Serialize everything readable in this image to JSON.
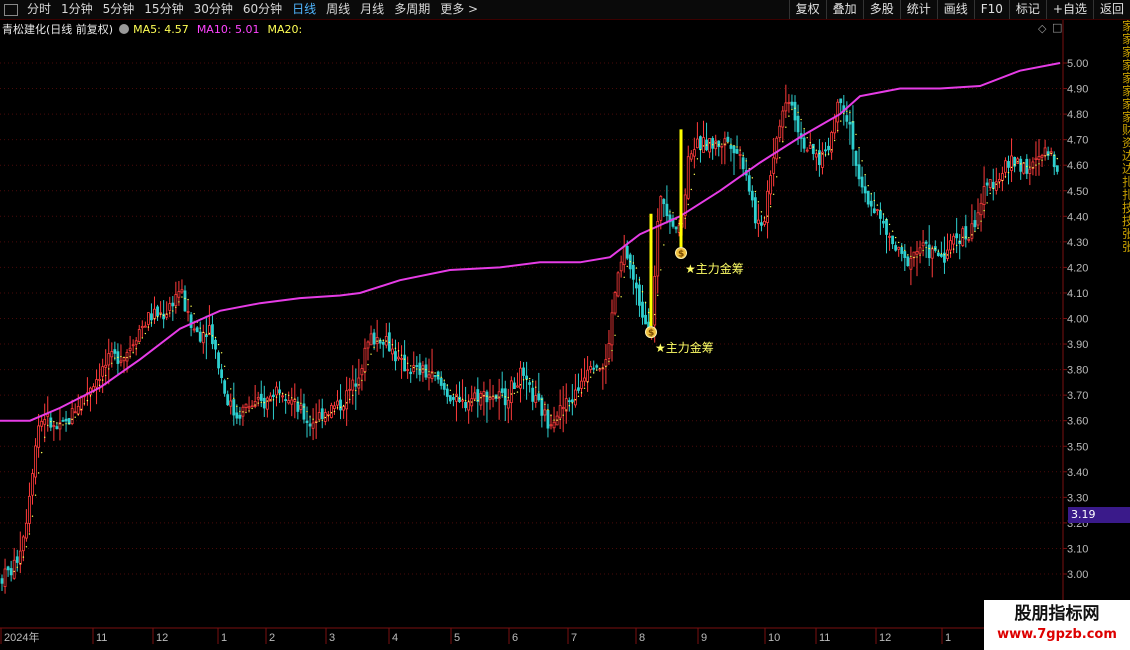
{
  "toolbar": {
    "periods": [
      "分时",
      "1分钟",
      "5分钟",
      "15分钟",
      "30分钟",
      "60分钟",
      "日线",
      "周线",
      "月线",
      "多周期",
      "更多 >"
    ],
    "active_index": 6,
    "right_buttons": [
      "复权",
      "叠加",
      "多股",
      "统计",
      "画线",
      "F10",
      "标记",
      "+自选",
      "返回"
    ]
  },
  "title": {
    "stock": "青松建化(日线 前复权)",
    "ma5": "MA5: 4.57",
    "ma10": "MA10: 5.01",
    "ma20": "MA20:"
  },
  "side_strip_text": "家家家家家家家家财资达达扎扎技技张张",
  "current_price": "3.19",
  "watermark": {
    "title": "股朋指标网",
    "url": "www.7gpzb.com"
  },
  "chart_data": {
    "type": "candlestick",
    "ylim": [
      2.93,
      5.12
    ],
    "yticks": [
      "5.00",
      "4.90",
      "4.80",
      "4.70",
      "4.60",
      "4.50",
      "4.40",
      "4.30",
      "4.20",
      "4.10",
      "4.00",
      "3.90",
      "3.80",
      "3.70",
      "3.60",
      "3.50",
      "3.40",
      "3.30",
      "3.20",
      "3.10",
      "3.00"
    ],
    "xticks": [
      "2024年",
      "11",
      "12",
      "1",
      "2",
      "3",
      "4",
      "5",
      "6",
      "7",
      "8",
      "9",
      "10",
      "11",
      "12",
      "1"
    ],
    "annotations": [
      {
        "label": "★主力金筹",
        "value": 3.97,
        "bar_low": 3.97,
        "bar_high": 4.41
      },
      {
        "label": "★主力金筹",
        "value": 4.28,
        "bar_low": 4.28,
        "bar_high": 4.74
      }
    ],
    "long_ma_color": "#e63ce6",
    "up_color": "#ff3b3b",
    "down_color": "#2ecfcf",
    "short_ma_color": "#ffff55",
    "long_ma_points": [
      [
        0,
        3.6
      ],
      [
        30,
        3.6
      ],
      [
        60,
        3.65
      ],
      [
        100,
        3.73
      ],
      [
        140,
        3.84
      ],
      [
        180,
        3.96
      ],
      [
        220,
        4.03
      ],
      [
        260,
        4.06
      ],
      [
        300,
        4.08
      ],
      [
        340,
        4.09
      ],
      [
        360,
        4.1
      ],
      [
        400,
        4.15
      ],
      [
        450,
        4.19
      ],
      [
        500,
        4.2
      ],
      [
        540,
        4.22
      ],
      [
        580,
        4.22
      ],
      [
        610,
        4.24
      ],
      [
        640,
        4.33
      ],
      [
        680,
        4.4
      ],
      [
        720,
        4.5
      ],
      [
        760,
        4.61
      ],
      [
        800,
        4.71
      ],
      [
        840,
        4.8
      ],
      [
        860,
        4.87
      ],
      [
        900,
        4.9
      ],
      [
        940,
        4.9
      ],
      [
        980,
        4.91
      ],
      [
        1020,
        4.97
      ],
      [
        1060,
        5.0
      ]
    ],
    "price_path": [
      [
        0,
        2.98
      ],
      [
        15,
        3.03
      ],
      [
        25,
        3.18
      ],
      [
        32,
        3.4
      ],
      [
        38,
        3.58
      ],
      [
        45,
        3.62
      ],
      [
        55,
        3.56
      ],
      [
        65,
        3.58
      ],
      [
        80,
        3.68
      ],
      [
        95,
        3.76
      ],
      [
        110,
        3.84
      ],
      [
        125,
        3.86
      ],
      [
        138,
        3.95
      ],
      [
        150,
        4.01
      ],
      [
        165,
        4.02
      ],
      [
        180,
        4.12
      ],
      [
        190,
        3.97
      ],
      [
        200,
        3.94
      ],
      [
        210,
        3.97
      ],
      [
        225,
        3.71
      ],
      [
        235,
        3.62
      ],
      [
        250,
        3.66
      ],
      [
        265,
        3.67
      ],
      [
        280,
        3.74
      ],
      [
        295,
        3.66
      ],
      [
        310,
        3.59
      ],
      [
        325,
        3.64
      ],
      [
        340,
        3.66
      ],
      [
        355,
        3.75
      ],
      [
        370,
        3.92
      ],
      [
        385,
        3.93
      ],
      [
        400,
        3.82
      ],
      [
        415,
        3.8
      ],
      [
        430,
        3.78
      ],
      [
        445,
        3.72
      ],
      [
        460,
        3.66
      ],
      [
        475,
        3.7
      ],
      [
        490,
        3.7
      ],
      [
        505,
        3.69
      ],
      [
        520,
        3.78
      ],
      [
        535,
        3.68
      ],
      [
        548,
        3.6
      ],
      [
        560,
        3.64
      ],
      [
        575,
        3.7
      ],
      [
        590,
        3.84
      ],
      [
        605,
        3.8
      ],
      [
        615,
        4.1
      ],
      [
        625,
        4.28
      ],
      [
        635,
        4.12
      ],
      [
        645,
        4.0
      ],
      [
        652,
        3.98
      ],
      [
        660,
        4.5
      ],
      [
        670,
        4.4
      ],
      [
        680,
        4.33
      ],
      [
        690,
        4.67
      ],
      [
        700,
        4.68
      ],
      [
        715,
        4.68
      ],
      [
        730,
        4.7
      ],
      [
        745,
        4.6
      ],
      [
        755,
        4.4
      ],
      [
        762,
        4.33
      ],
      [
        770,
        4.57
      ],
      [
        780,
        4.78
      ],
      [
        790,
        4.88
      ],
      [
        800,
        4.72
      ],
      [
        810,
        4.65
      ],
      [
        820,
        4.62
      ],
      [
        830,
        4.7
      ],
      [
        840,
        4.88
      ],
      [
        850,
        4.76
      ],
      [
        860,
        4.5
      ],
      [
        875,
        4.43
      ],
      [
        890,
        4.3
      ],
      [
        905,
        4.22
      ],
      [
        920,
        4.28
      ],
      [
        935,
        4.25
      ],
      [
        945,
        4.25
      ],
      [
        955,
        4.32
      ],
      [
        970,
        4.33
      ],
      [
        985,
        4.5
      ],
      [
        1000,
        4.57
      ],
      [
        1015,
        4.62
      ],
      [
        1030,
        4.58
      ],
      [
        1045,
        4.65
      ],
      [
        1058,
        4.6
      ]
    ]
  }
}
